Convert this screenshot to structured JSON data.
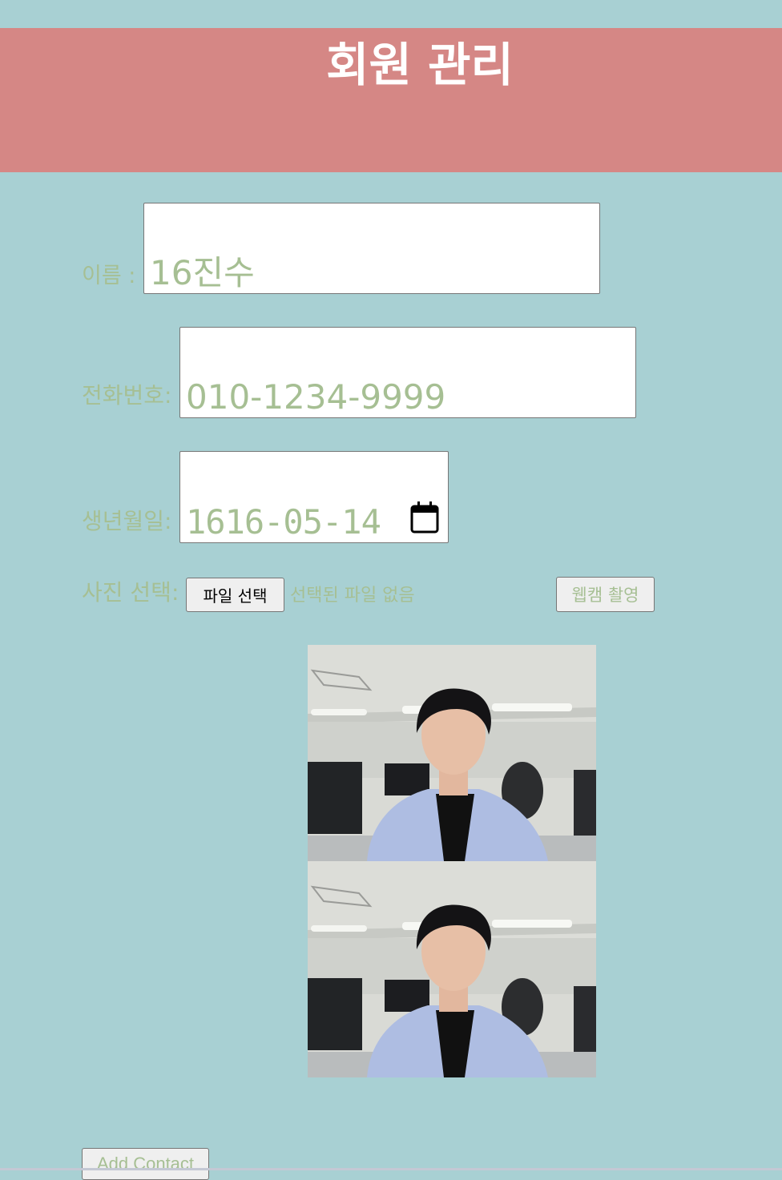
{
  "header": {
    "title": "회원 관리"
  },
  "form": {
    "name": {
      "label": "이름 :",
      "value": "16진수"
    },
    "phone": {
      "label": "전화번호:",
      "value": "010-1234-9999"
    },
    "birthdate": {
      "label": "생년월일:",
      "value": "1616-05-14"
    },
    "photo": {
      "label": "사진 선택:",
      "file_button": "파일 선택",
      "file_status": "선택된 파일 없음",
      "webcam_button": "웹캠 촬영"
    },
    "submit_label": "Add Contact"
  },
  "icons": {
    "date_picker": "calendar-icon"
  },
  "colors": {
    "background": "#a8d0d3",
    "header": "#d58785",
    "label_text": "#a6bf93",
    "title_text": "#ffffff"
  }
}
